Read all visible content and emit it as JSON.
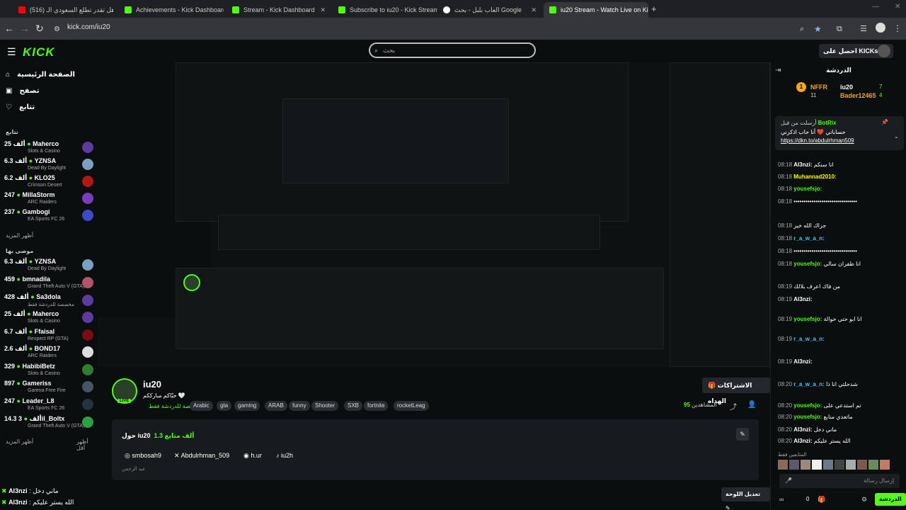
{
  "browser": {
    "tabs": [
      {
        "label": "(516) هل تقدر تطلع السعودي الـ…",
        "color": "#ff0000"
      },
      {
        "label": "Achievements - Kick Dashboard",
        "color": "#53fc18"
      },
      {
        "label": "Stream - Kick Dashboard",
        "color": "#53fc18"
      },
      {
        "label": "Subscribe to iu20 - Kick Stream…",
        "color": "#53fc18"
      },
      {
        "label": "العاب بلبل - بحث Google",
        "color": "#ffffff"
      },
      {
        "label": "iu20 Stream - Watch Live on Kick",
        "color": "#53fc18"
      }
    ],
    "url": "kick.com/iu20",
    "new_tab": "+"
  },
  "header": {
    "logo": "KICK",
    "search_placeholder": "بحث",
    "get_app": "احصل على KICKs"
  },
  "sidebar": {
    "nav": [
      {
        "label": "الصفحة الرئيسية",
        "icon": "home-icon"
      },
      {
        "label": "تصفح",
        "icon": "browse-icon"
      },
      {
        "label": "تتابع",
        "icon": "heart-icon"
      }
    ],
    "following_label": "تتابع",
    "following": [
      {
        "viewers": "25 ألف",
        "name": "Maherco",
        "game": "Slots & Casino"
      },
      {
        "viewers": "6.3 ألف",
        "name": "YZNSA",
        "game": "Dead By Daylight"
      },
      {
        "viewers": "6.2 ألف",
        "name": "KLO25",
        "game": "Crimson Desert"
      },
      {
        "viewers": "247",
        "name": "MillaStorm",
        "game": "ARC Raiders"
      },
      {
        "viewers": "237",
        "name": "Gambogi",
        "game": "EA Sports FC 26"
      }
    ],
    "show_more": "أظهر المزيد",
    "recommended_label": "موصى بها",
    "recommended": [
      {
        "viewers": "6.3 ألف",
        "name": "YZNSA",
        "game": "Dead By Daylight"
      },
      {
        "viewers": "459",
        "name": "bmnadila",
        "game": "Grand Theft Auto V (GTA)"
      },
      {
        "viewers": "428 ألف",
        "name": "Sa3dola",
        "game": "مخصصة للدردشة فقط"
      },
      {
        "viewers": "25 ألف",
        "name": "Maherco",
        "game": "Slots & Casino"
      },
      {
        "viewers": "6.7 ألف",
        "name": "Ffaisal",
        "game": "Respect RP (GTA)"
      },
      {
        "viewers": "2.6 ألف",
        "name": "BOND17",
        "game": "ARC Raiders"
      },
      {
        "viewers": "329",
        "name": "HabibiBetz",
        "game": "Slots & Casino"
      },
      {
        "viewers": "897",
        "name": "Gameriss",
        "game": "Garena Free Fire"
      },
      {
        "viewers": "247",
        "name": "Leader_L8",
        "game": "EA Sports FC 26"
      },
      {
        "viewers": "14.3 ألف",
        "name": "3il_Boltx",
        "game": "Grand Theft Auto V (GTA)"
      }
    ],
    "show_more_2": "أظهر المزيد",
    "show_less": "أظهر أقل"
  },
  "channel": {
    "name": "iu20",
    "live": "LIVE",
    "title": "حيّاكم مبارككم 🤍",
    "category": "مخصصة للدردشة فقط",
    "tags": [
      "Arabic",
      "gta",
      "gaming",
      "ARAB",
      "funny",
      "Shooter",
      "SXB",
      "fortnite",
      "rocketLeag"
    ],
    "subscriptions_button": "الاشتراكات الهداه",
    "viewers_label": "المشاهدين",
    "viewers_count": "95",
    "about_title": "حول iu20",
    "followers": "1.3 ألف متابع",
    "socials": [
      {
        "label": "smbosah9",
        "icon": "instagram-icon"
      },
      {
        "label": "Abdulrhman_509",
        "icon": "x-icon"
      },
      {
        "label": "h.ur",
        "icon": "discord-icon"
      },
      {
        "label": "iu2h",
        "icon": "tiktok-icon"
      }
    ],
    "about_desc": "عبد الرحمن",
    "edit_panel": "تعديل اللوحة"
  },
  "chat": {
    "title": "الدردشة",
    "leaderboard": [
      {
        "name": "NFFR",
        "count": "11"
      },
      {
        "name": "iu20",
        "count": "7"
      },
      {
        "name": "Bader12465",
        "count": "4"
      }
    ],
    "pinned_by": "أرسلت من قبل",
    "pinned_user": "BotRix",
    "pinned_text": "حساباتي ❤️ أنا حاب اذكرني",
    "pinned_link": "https://dkn.to/abdulrhman509",
    "messages": [
      {
        "time": "08:18",
        "user": "Al3nzi:",
        "text": "انا سنكم",
        "color": "#ffffff"
      },
      {
        "time": "08:18",
        "user": "Muhannad2010:",
        "text": "",
        "color": "#ffff00"
      },
      {
        "time": "08:18",
        "user": "yousefsjo:",
        "text": "",
        "color": "#53fc18"
      },
      {
        "time": "08:18",
        "user": "",
        "text": "••••••••••••••••••••••••••••••••",
        "color": "#ffffff"
      },
      {
        "time": "08:18",
        "user": "",
        "text": "جزاك الله خير",
        "color": "#ffffff"
      },
      {
        "time": "08:18",
        "user": "r_a_w_a_n:",
        "text": "",
        "color": "#4fc3f7"
      },
      {
        "time": "08:18",
        "user": "",
        "text": "••••••••••••••••••••••••••••••••",
        "color": "#ffffff"
      },
      {
        "time": "08:18",
        "user": "yousefsjo:",
        "text": "انا طفران سالي",
        "color": "#53fc18"
      },
      {
        "time": "08:19",
        "user": "",
        "text": "من فاك اعرف بلالك",
        "color": "#ffffff"
      },
      {
        "time": "08:19",
        "user": "Al3nzi:",
        "text": "",
        "color": "#ffffff"
      },
      {
        "time": "08:19",
        "user": "yousefsjo:",
        "text": "انا ابو حتي حوالة",
        "color": "#53fc18"
      },
      {
        "time": "08:19",
        "user": "r_a_w_a_n:",
        "text": "",
        "color": "#4fc3f7"
      },
      {
        "time": "08:19",
        "user": "Al3nzi:",
        "text": "",
        "color": "#ffffff"
      },
      {
        "time": "08:20",
        "user": "r_a_w_a_n:",
        "text": "شدحلتي انا ذا",
        "color": "#4fc3f7"
      },
      {
        "time": "08:20",
        "user": "yousefsjo:",
        "text": "تم استدعي على",
        "color": "#53fc18"
      },
      {
        "time": "08:20",
        "user": "yousefsjo:",
        "text": "ماتعدي منابع",
        "color": "#53fc18"
      },
      {
        "time": "08:20",
        "user": "Al3nzi:",
        "text": "ماني دخل",
        "color": "#ffffff"
      },
      {
        "time": "08:20",
        "user": "Al3nzi:",
        "text": "الله يستر عليكم",
        "color": "#ffffff"
      }
    ],
    "active_label": "المتابعين فقط",
    "input_placeholder": "إرسال رسالة",
    "send": "الدردشة",
    "kicks_count": "0"
  },
  "overlay": {
    "lines": [
      {
        "user": "Al3nzi",
        "text": "ماني دخل"
      },
      {
        "user": "Al3nzi",
        "text": "الله يستر عليكم"
      }
    ]
  },
  "colors": {
    "accent": "#53fc18",
    "bg": "#0b0e0f",
    "panel": "#181b1e"
  }
}
